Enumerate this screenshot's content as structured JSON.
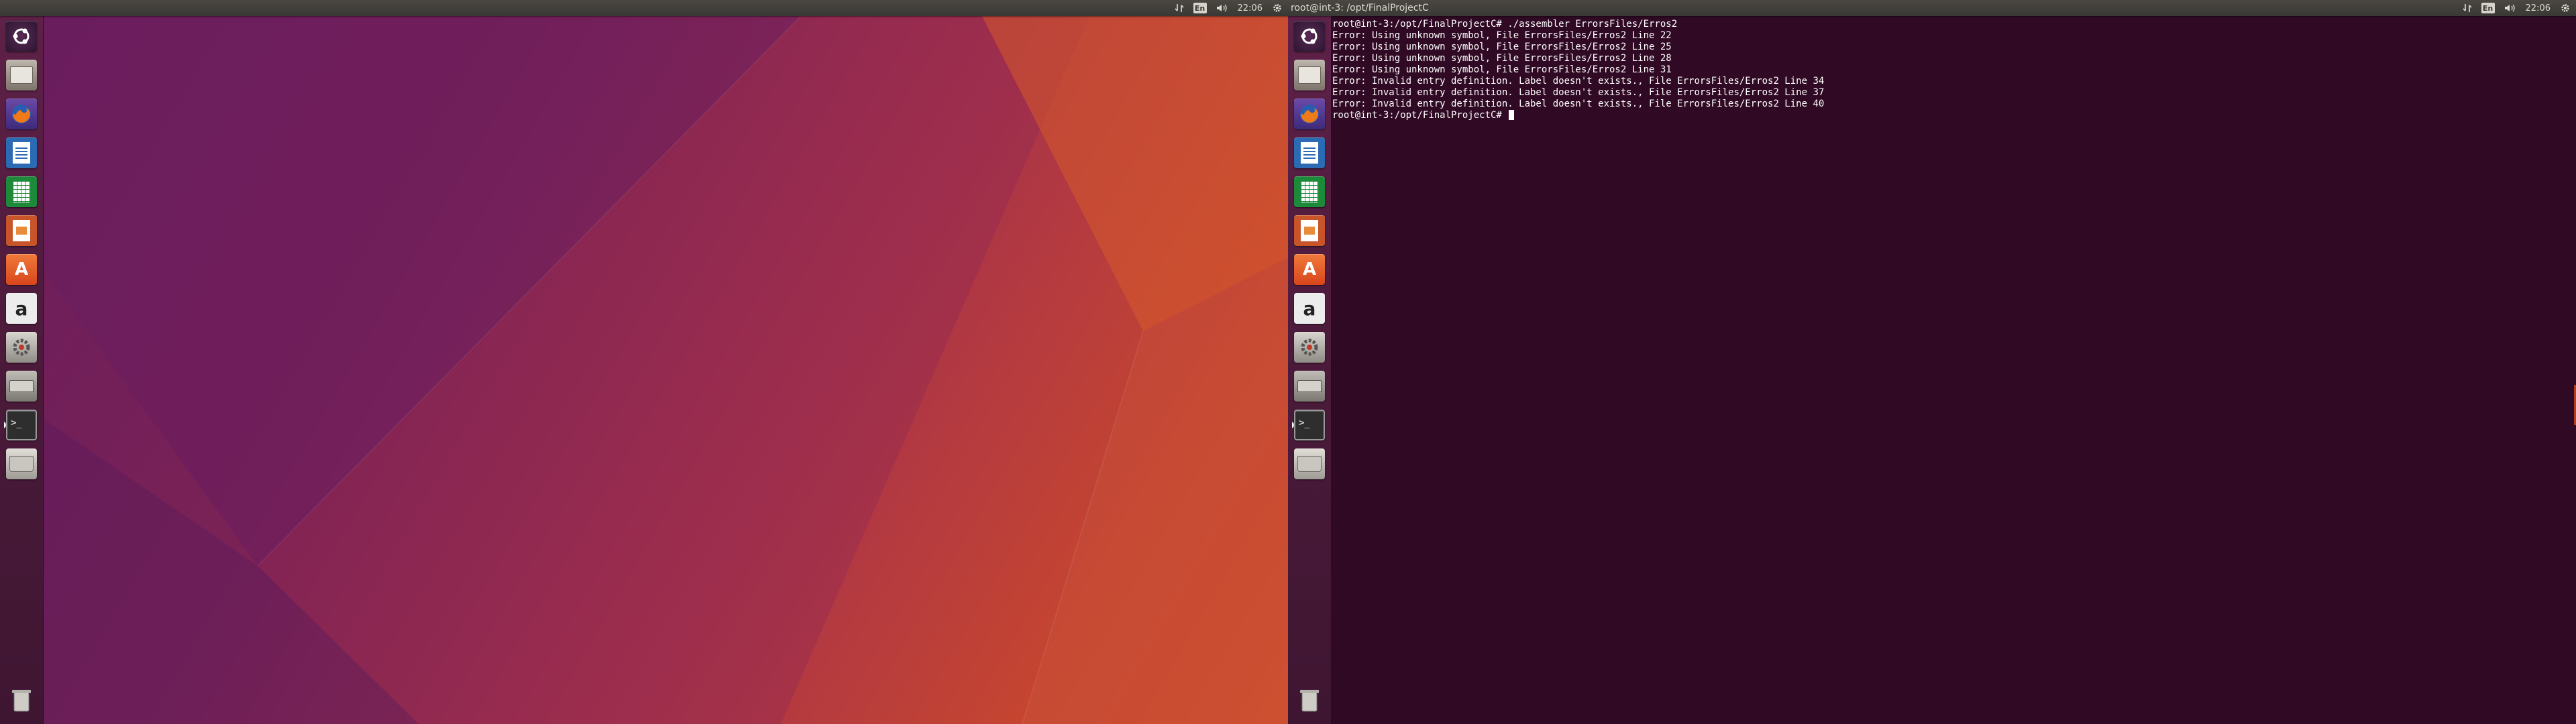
{
  "top_panel": {
    "window_title": "root@int-3: /opt/FinalProjectC",
    "keyboard_layout": "En",
    "clock": "22:06",
    "icons": [
      "network-icon",
      "keyboard-layout-indicator",
      "volume-icon",
      "gear-icon"
    ]
  },
  "launcher": {
    "items": [
      {
        "name": "ubuntu-dash-icon",
        "color": "#2b1530"
      },
      {
        "name": "files-icon",
        "color": "#8a7f74"
      },
      {
        "name": "firefox-icon",
        "color": "#e66000"
      },
      {
        "name": "libreoffice-writer-icon",
        "color": "#2a6bb3"
      },
      {
        "name": "libreoffice-calc-icon",
        "color": "#1d8a3a"
      },
      {
        "name": "libreoffice-impress-icon",
        "color": "#d8542a"
      },
      {
        "name": "ubuntu-software-icon",
        "color": "#e9581f"
      },
      {
        "name": "amazon-icon",
        "color": "#ececec"
      },
      {
        "name": "system-settings-icon",
        "color": "#b8b4ae"
      },
      {
        "name": "disk-drive-icon",
        "color": "#9e9a94"
      },
      {
        "name": "terminal-icon",
        "color": "#2e2e2e"
      },
      {
        "name": "usb-drive-icon",
        "color": "#c7c3bd"
      }
    ],
    "trash": {
      "name": "trash-icon"
    }
  },
  "terminal": {
    "lines": [
      "root@int-3:/opt/FinalProjectC# ./assembler ErrorsFiles/Erros2",
      "Error: Using unknown symbol, File ErrorsFiles/Erros2 Line 22",
      "Error: Using unknown symbol, File ErrorsFiles/Erros2 Line 25",
      "Error: Using unknown symbol, File ErrorsFiles/Erros2 Line 28",
      "Error: Using unknown symbol, File ErrorsFiles/Erros2 Line 31",
      "Error: Invalid entry definition. Label doesn't exists., File ErrorsFiles/Erros2 Line 34",
      "Error: Invalid entry definition. Label doesn't exists., File ErrorsFiles/Erros2 Line 37",
      "Error: Invalid entry definition. Label doesn't exists., File ErrorsFiles/Erros2 Line 40"
    ],
    "prompt": "root@int-3:/opt/FinalProjectC# "
  }
}
